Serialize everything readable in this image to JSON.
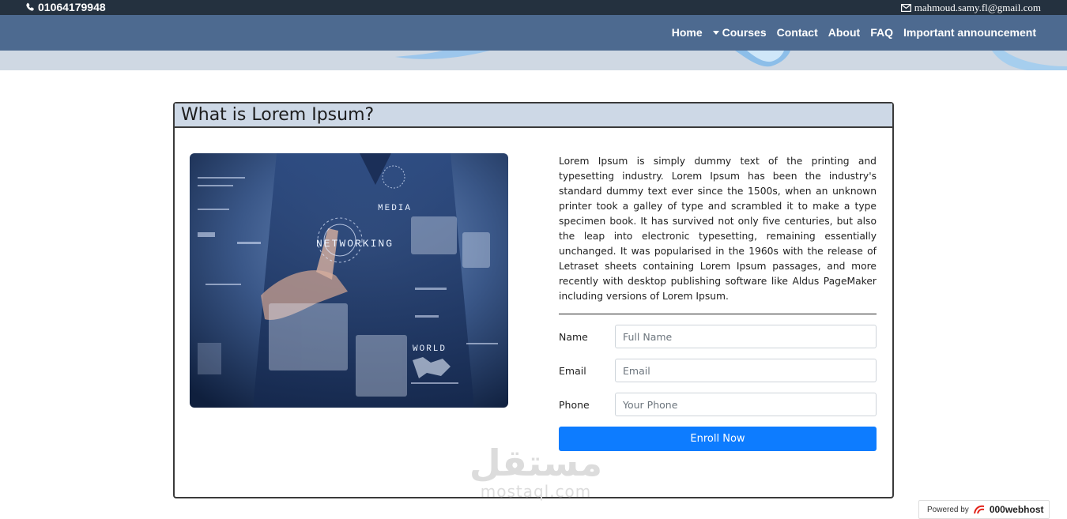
{
  "topbar": {
    "phone": "01064179948",
    "email": "mahmoud.samy.fl@gmail.com",
    "phone_icon": "phone-icon",
    "email_icon": "envelope-icon"
  },
  "nav": {
    "items": [
      {
        "label": "Home"
      },
      {
        "label": "Courses"
      },
      {
        "label": "Contact"
      },
      {
        "label": "About"
      },
      {
        "label": "FAQ"
      },
      {
        "label": "Important announcement"
      }
    ]
  },
  "card": {
    "title": "What is Lorem Ipsum?",
    "photo_words": {
      "media": "MEDIA",
      "networking": "NETWORKING",
      "world": "WORLD"
    },
    "body": "Lorem Ipsum is simply dummy text of the printing and typesetting industry. Lorem Ipsum has been the industry's standard dummy text ever since the 1500s, when an unknown printer took a galley of type and scrambled it to make a type specimen book. It has survived not only five centuries, but also the leap into electronic typesetting, remaining essentially unchanged. It was popularised in the 1960s with the release of Letraset sheets containing Lorem Ipsum passages, and more recently with desktop publishing software like Aldus PageMaker including versions of Lorem Ipsum."
  },
  "form": {
    "name_label": "Name",
    "name_placeholder": "Full Name",
    "email_label": "Email",
    "email_placeholder": "Email",
    "phone_label": "Phone",
    "phone_placeholder": "Your Phone",
    "submit_label": "Enroll Now"
  },
  "watermark": {
    "arabic": "مستقل",
    "latin": "mostaql.com"
  },
  "footer": {
    "powered_by": "Powered by",
    "brand": "000webhost"
  },
  "colors": {
    "topbar": "#24313f",
    "navbar": "#4d6a90",
    "card_header": "#cdd8e6",
    "button": "#0d7cff"
  }
}
